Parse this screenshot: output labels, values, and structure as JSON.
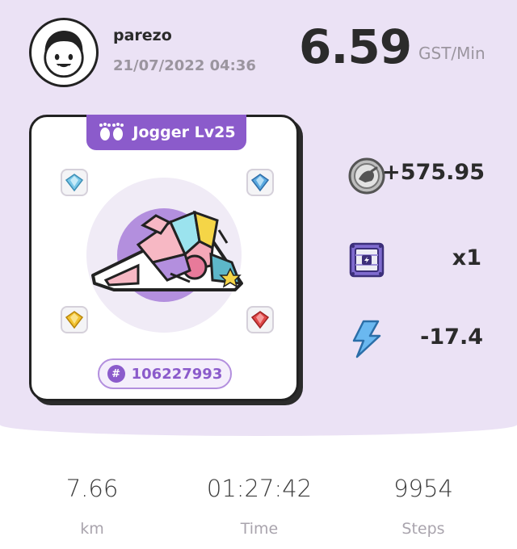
{
  "user": {
    "name": "parezo",
    "timestamp": "21/07/2022 04:36"
  },
  "earning_rate": {
    "value": "6.59",
    "unit": "GST/Min"
  },
  "sneaker": {
    "type_label": "Jogger Lv25",
    "id": "106227993",
    "id_symbol": "#",
    "sockets": [
      {
        "position": "top-left",
        "gem": "diamond-gem",
        "color": "#79c7e8"
      },
      {
        "position": "top-right",
        "gem": "diamond-gem",
        "color": "#5aa9e0"
      },
      {
        "position": "bottom-left",
        "gem": "topaz-gem",
        "color": "#f2c230"
      },
      {
        "position": "bottom-right",
        "gem": "ruby-gem",
        "color": "#e04848"
      }
    ]
  },
  "rewards": {
    "gst_earned": "+575.95",
    "mystery_box_count": "x1",
    "energy_used": "-17.4"
  },
  "summary": {
    "distance_value": "7.66",
    "distance_label": "km",
    "time_value": "01:27:42",
    "time_label": "Time",
    "steps_value": "9954",
    "steps_label": "Steps"
  },
  "colors": {
    "background_lavender": "#ebe2f5",
    "accent_purple": "#8b5bcb",
    "energy_blue": "#6ab8f0"
  }
}
